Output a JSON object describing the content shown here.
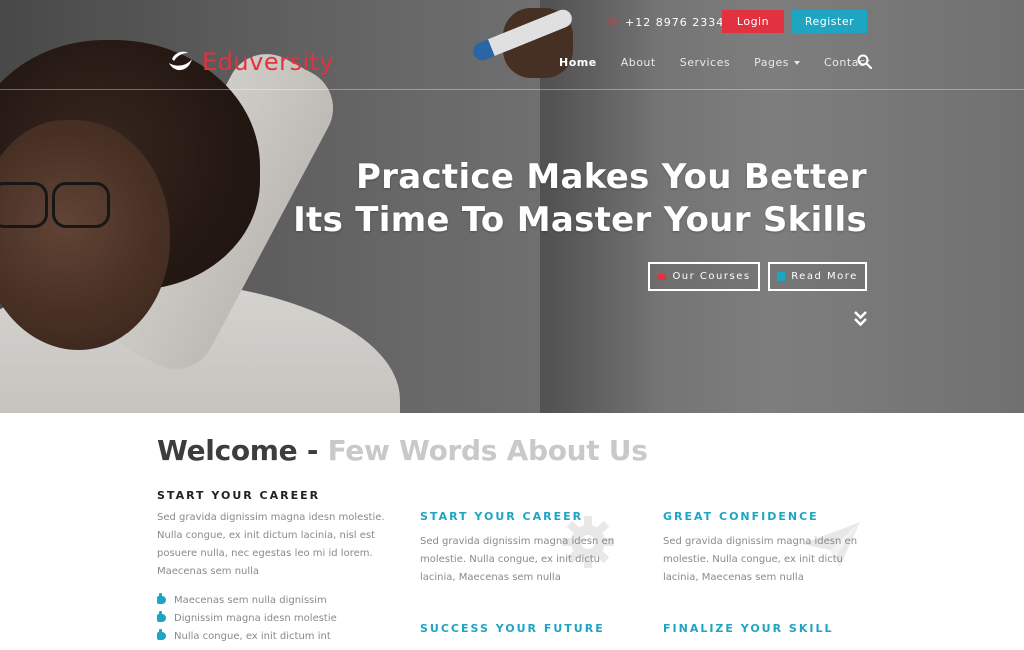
{
  "topbar": {
    "phone": "+12 8976 2334",
    "login_label": "Login",
    "register_label": "Register"
  },
  "brand": {
    "name": "Eduversity",
    "accent_color": "#e2323f",
    "secondary_color": "#1ea5c2"
  },
  "nav": {
    "items": [
      {
        "label": "Home",
        "active": true
      },
      {
        "label": "About"
      },
      {
        "label": "Services"
      },
      {
        "label": "Pages",
        "dropdown": true
      },
      {
        "label": "Contact"
      }
    ],
    "search_icon": "search-icon"
  },
  "hero": {
    "title_line1": "Practice Makes You Better",
    "title_line2": "Its Time To Master Your Skills",
    "courses_label": "Our Courses",
    "readmore_label": "Read More",
    "scroll_icon": "double-chevron-down-icon"
  },
  "welcome": {
    "heading_dark": "Welcome - ",
    "heading_light": "Few Words About Us"
  },
  "intro": {
    "title": "START YOUR CAREER",
    "body": "Sed gravida dignissim magna idesn molestie. Nulla congue, ex init dictum lacinia, nisl est posuere nulla, nec egestas leo mi id lorem. Maecenas sem nulla",
    "bullets": [
      "Maecenas sem nulla dignissim",
      "Dignissim magna idesn molestie",
      "Nulla congue, ex init dictum int"
    ]
  },
  "features": [
    {
      "title": "START YOUR CAREER",
      "body": "Sed gravida dignissim magna idesn en molestie. Nulla congue, ex init dictu lacinia, Maecenas sem nulla",
      "icon": "gear-icon"
    },
    {
      "title": "GREAT CONFIDENCE",
      "body": "Sed gravida dignissim magna idesn en molestie. Nulla congue, ex init dictu lacinia, Maecenas sem nulla",
      "icon": "paper-plane-icon"
    },
    {
      "title": "SUCCESS YOUR FUTURE"
    },
    {
      "title": "FINALIZE YOUR SKILL"
    }
  ]
}
